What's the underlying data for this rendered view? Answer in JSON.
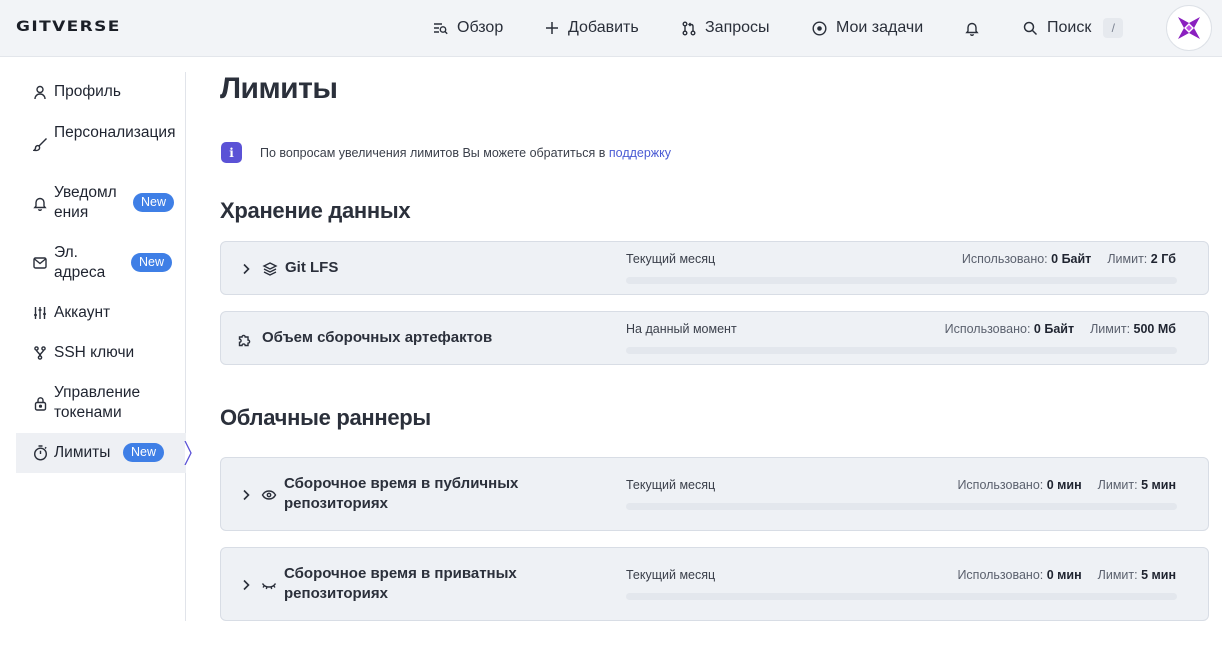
{
  "header": {
    "logo": "GITVERSE",
    "nav": {
      "overview": "Обзор",
      "add": "Добавить",
      "requests": "Запросы",
      "tasks": "Мои задачи",
      "search": "Поиск",
      "search_shortcut": "/"
    }
  },
  "sidebar": {
    "items": [
      {
        "label": "Профиль",
        "icon": "user-icon"
      },
      {
        "label": "Персонализация",
        "icon": "brush-icon"
      },
      {
        "label": "Уведомл\nения",
        "icon": "bell-icon",
        "badge": "New"
      },
      {
        "label": "Эл.\nадреса",
        "icon": "mail-icon",
        "badge": "New"
      },
      {
        "label": "Аккаунт",
        "icon": "sliders-icon"
      },
      {
        "label": "SSH ключи",
        "icon": "key-fork-icon"
      },
      {
        "label": "Управление\nтокенами",
        "icon": "lock-icon"
      },
      {
        "label": "Лимиты",
        "icon": "stopwatch-icon",
        "badge": "New",
        "active": true
      }
    ]
  },
  "main": {
    "title": "Лимиты",
    "info": {
      "text": "По вопросам увеличения лимитов Вы можете обратиться в",
      "link": "поддержку"
    },
    "storage": {
      "title": "Хранение данных",
      "cards": [
        {
          "title": "Git LFS",
          "period": "Текущий месяц",
          "used_label": "Использовано:",
          "used": "0 Байт",
          "limit_label": "Лимит:",
          "limit": "2 Гб",
          "progress": 0
        },
        {
          "title": "Объем сборочных артефактов",
          "period": "На данный момент",
          "used_label": "Использовано:",
          "used": "0 Байт",
          "limit_label": "Лимит:",
          "limit": "500 Мб",
          "progress": 0
        }
      ]
    },
    "runners": {
      "title": "Облачные раннеры",
      "cards": [
        {
          "title": "Сборочное время в публичных\nрепозиториях",
          "period": "Текущий месяц",
          "used_label": "Использовано:",
          "used": "0 мин",
          "limit_label": "Лимит:",
          "limit": "5 мин",
          "progress": 0
        },
        {
          "title": "Сборочное время в приватных\nрепозиториях",
          "period": "Текущий месяц",
          "used_label": "Использовано:",
          "used": "0 мин",
          "limit_label": "Лимит:",
          "limit": "5 мин",
          "progress": 0
        }
      ]
    }
  },
  "colors": {
    "accent": "#5b52d6",
    "badge": "#3f7fe6",
    "avatar": "#8a1fbf"
  }
}
